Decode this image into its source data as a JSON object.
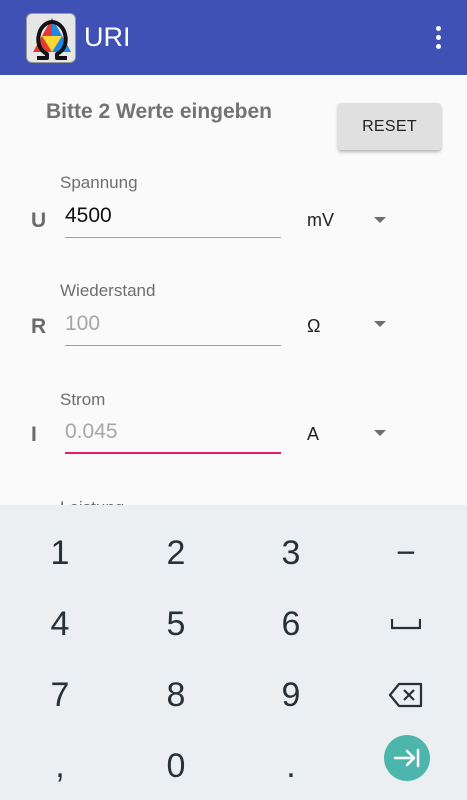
{
  "app": {
    "title": "URI",
    "logo_name": "uri-triangle-omega-logo",
    "accent_color": "#3f51b5"
  },
  "form": {
    "hint": "Bitte 2 Werte eingeben",
    "reset_label": "RESET",
    "fields": [
      {
        "label": "Spannung",
        "letter": "U",
        "value": "4500",
        "placeholder": "",
        "unit": "mV"
      },
      {
        "label": "Wiederstand",
        "letter": "R",
        "value": "",
        "placeholder": "100",
        "unit": "Ω"
      },
      {
        "label": "Strom",
        "letter": "I",
        "value": "",
        "placeholder": "0.045",
        "unit": "A"
      },
      {
        "label": "Leistung"
      }
    ],
    "active_field_color": "#e91e63"
  },
  "keyboard": {
    "keys": [
      "1",
      "2",
      "3",
      "−",
      "4",
      "5",
      "6",
      "7",
      "8",
      "9",
      ",",
      "0",
      "."
    ],
    "space_icon": "space-bar-icon",
    "backspace_icon": "backspace-icon",
    "enter_icon": "next-field-icon",
    "enter_color": "#4db6ac"
  }
}
